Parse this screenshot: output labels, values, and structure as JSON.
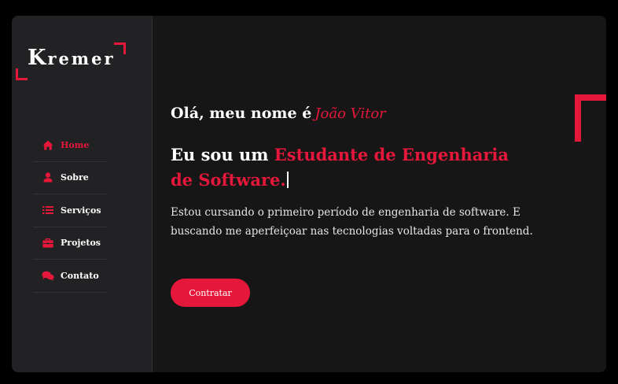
{
  "brand": {
    "logo_first": "K",
    "logo_rest": "remer",
    "accent": "#e5173a"
  },
  "sidebar": {
    "items": [
      {
        "label": "Home",
        "icon": "home-icon",
        "active": true
      },
      {
        "label": "Sobre",
        "icon": "user-icon",
        "active": false
      },
      {
        "label": "Serviços",
        "icon": "list-icon",
        "active": false
      },
      {
        "label": "Projetos",
        "icon": "briefcase-icon",
        "active": false
      },
      {
        "label": "Contato",
        "icon": "chat-icon",
        "active": false
      }
    ]
  },
  "hero": {
    "greeting": "Olá, meu nome é",
    "name": "João Vitor",
    "headline_prefix": "Eu sou um",
    "headline_accent": "Estudante de Engenharia de Software.",
    "description": "Estou cursando o primeiro período de engenharia de software. E buscando me aperfeiçoar nas tecnologias voltadas para o frontend.",
    "cta_label": "Contratar"
  }
}
